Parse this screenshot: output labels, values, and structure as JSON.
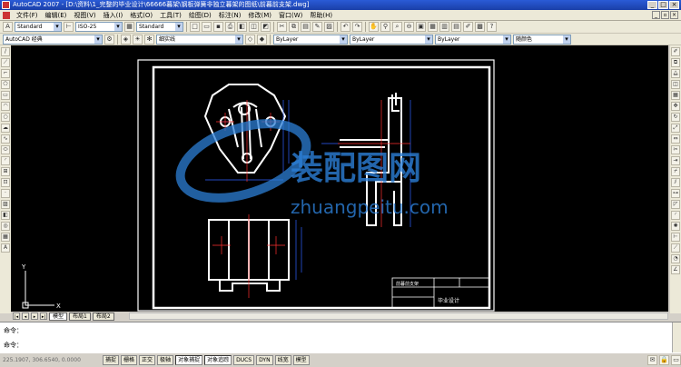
{
  "window": {
    "title": "AutoCAD 2007 - [D:\\资料\\1_完整的毕业设计\\66666暮架\\钢板弹簧非独立暮架的图纸\\前暮前支架.dwg]"
  },
  "menubar": {
    "items": [
      "文件(F)",
      "编辑(E)",
      "视图(V)",
      "插入(I)",
      "格式(O)",
      "工具(T)",
      "绘图(D)",
      "标注(N)",
      "修改(M)",
      "窗口(W)",
      "帮助(H)"
    ]
  },
  "toolbar1": {
    "text_style": "Standard",
    "dim_style": "ISO-25",
    "table_style": "Standard"
  },
  "toolbar2": {
    "workspace": "AutoCAD 经典",
    "layer_name": "细实线",
    "color": "ByLayer",
    "linetype": "ByLayer",
    "lineweight": "ByLayer",
    "plotstyle": "随颜色"
  },
  "drawing": {
    "title_block_cells": [
      "前暮前支架",
      "毕业设计"
    ],
    "ucs_y": "Y",
    "ucs_x": "X"
  },
  "watermark": {
    "cn": "装配图网",
    "url": "zhuangpeitu.com"
  },
  "layout_tabs": [
    "模型",
    "布局1",
    "布局2"
  ],
  "command": {
    "line1": "命令：",
    "line2": "命令："
  },
  "statusbar": {
    "coords": "225.1907, 306.6540, 0.0000",
    "toggles": [
      "捕捉",
      "栅格",
      "正交",
      "极轴",
      "对象捕捉",
      "对象追踪",
      "DUCS",
      "DYN",
      "线宽",
      "模型"
    ]
  }
}
